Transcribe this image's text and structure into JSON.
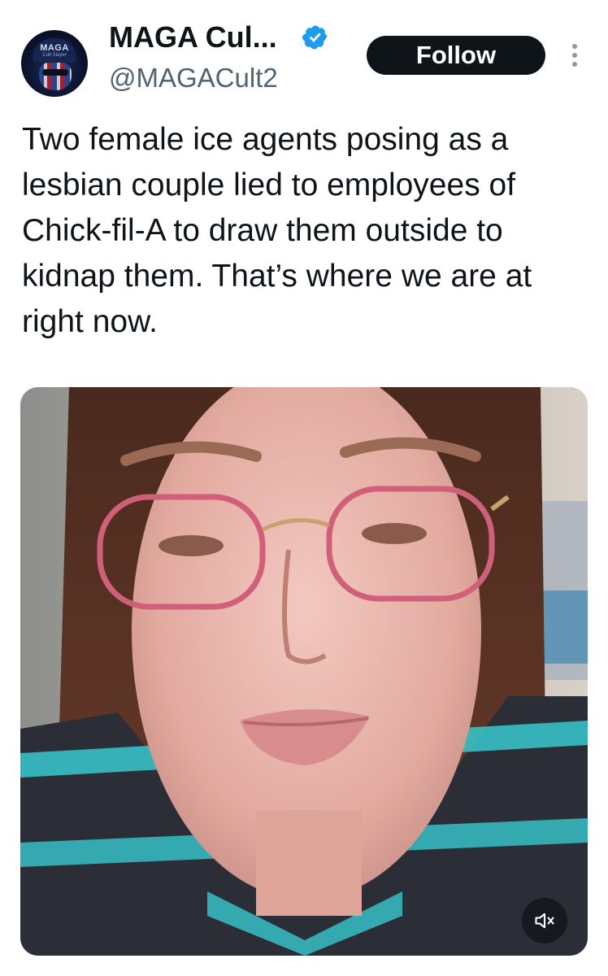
{
  "author": {
    "display_name": "MAGA Cul...",
    "handle": "@MAGACult2",
    "avatar_text": "MAGA",
    "avatar_subtext": "Cult Slayer",
    "verified": true
  },
  "actions": {
    "follow_label": "Follow",
    "more_icon": "more-vertical-icon"
  },
  "tweet": {
    "text": "Two female ice agents posing as a lesbian couple lied to employees of Chick-fil-A to draw them outside to kidnap them. That’s where we are at right now."
  },
  "media": {
    "type": "video",
    "mute_icon": "volume-muted-icon"
  },
  "colors": {
    "text_primary": "#0f1419",
    "text_secondary": "#536471",
    "verified_blue": "#1d9bf0",
    "follow_bg": "#0f1419",
    "follow_text": "#ffffff"
  }
}
